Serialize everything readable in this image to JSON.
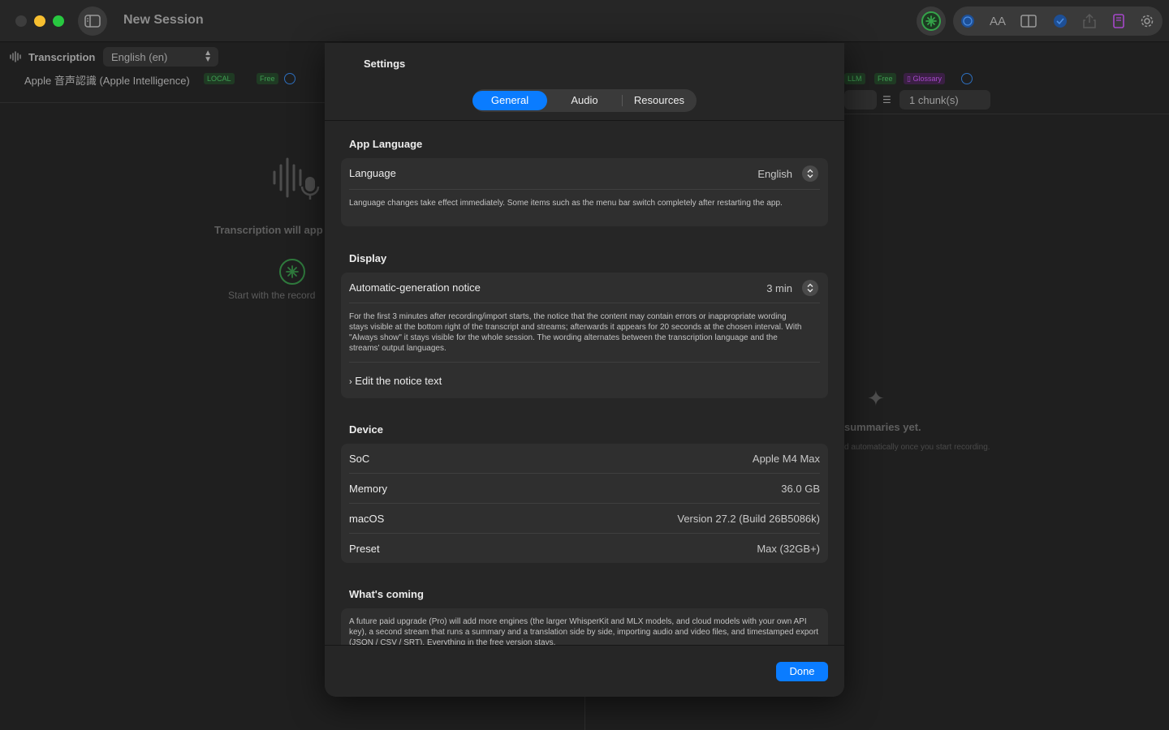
{
  "window": {
    "title": "New Session"
  },
  "left_pane": {
    "title": "Transcription",
    "language_select": "English (en)",
    "engine": "Apple 音声認識 (Apple Intelligence)",
    "badge_local": "LOCAL",
    "badge_free": "Free",
    "empty_text": "Transcription will app",
    "record_hint": "Start with the record"
  },
  "right_pane": {
    "badge_llm": "LLM",
    "badge_free": "Free",
    "badge_glossary": "Glossary",
    "chunk_select": "1 chunk(s)",
    "empty_text": "summaries yet.",
    "empty_sub": "d automatically once you start recording."
  },
  "settings": {
    "title": "Settings",
    "tabs": [
      {
        "label": "General",
        "selected": true
      },
      {
        "label": "Audio",
        "selected": false
      },
      {
        "label": "Resources",
        "selected": false
      }
    ],
    "app_language": {
      "section_title": "App Language",
      "label": "Language",
      "value": "English",
      "description": "Language changes take effect immediately. Some items such as the menu bar switch completely after restarting the app."
    },
    "display": {
      "section_title": "Display",
      "label": "Automatic-generation notice",
      "value": "3 min",
      "description": "For the first 3 minutes after recording/import starts, the notice that the content may contain errors or inappropriate wording stays visible at the bottom right of the transcript and streams; afterwards it appears for 20 seconds at the chosen interval. With \"Always show\" it stays visible for the whole session. The wording alternates between the transcription language and the streams' output languages.",
      "edit_link": "Edit the notice text"
    },
    "device": {
      "section_title": "Device",
      "rows": [
        {
          "label": "SoC",
          "value": "Apple M4 Max"
        },
        {
          "label": "Memory",
          "value": "36.0 GB"
        },
        {
          "label": "macOS",
          "value": "Version 27.2 (Build 26B5086k)"
        },
        {
          "label": "Preset",
          "value": "Max (32GB+)"
        }
      ]
    },
    "whats_coming": {
      "section_title": "What's coming",
      "description": "A future paid upgrade (Pro) will add more engines (the larger WhisperKit and MLX models, and cloud models with your own API key), a second stream that runs a summary and a translation side by side, importing audio and video files, and timestamped export (JSON / CSV / SRT). Everything in the free version stays."
    },
    "done_label": "Done"
  },
  "colors": {
    "accent": "#0a7cff",
    "local_badge": "#3f9e52",
    "glossary_badge": "#a548c9",
    "window_bg": "#1e1e1e",
    "sheet_bg": "#262626"
  }
}
